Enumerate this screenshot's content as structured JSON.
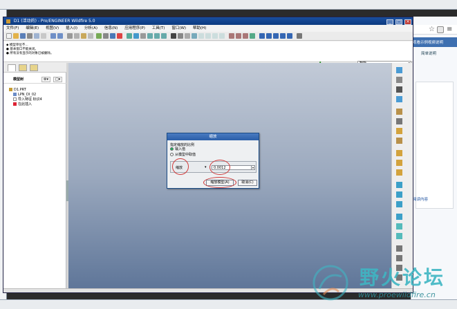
{
  "window": {
    "title": "D1 (活动的) - Pro/ENGINEER Wildfire 5.0"
  },
  "menubar": [
    "文件(F)",
    "编辑(E)",
    "视图(V)",
    "插入(I)",
    "分析(A)",
    "信息(N)",
    "应用程序(P)",
    "工具(T)",
    "窗口(W)",
    "帮助(H)"
  ],
  "message_area": {
    "lines": [
      "◆ 模型单位不...",
      "● 基本窗口不能关闭。",
      "● 所有没有显示的对象已被删除。"
    ],
    "selection_filter": "智能"
  },
  "navigator": {
    "title": "模型树",
    "settings_icon": "tree-settings-icon",
    "show_icon": "tree-show-icon",
    "items": [
      {
        "label": "D1.PRT",
        "icon": "part-icon"
      },
      {
        "label": "LPN_DI_02",
        "icon": "layer-icon"
      },
      {
        "label": "导入特征 标识4",
        "icon": "import-feature-icon"
      },
      {
        "label": "在此插入",
        "icon": "insert-here-icon"
      }
    ]
  },
  "dialog": {
    "title": "缩放",
    "prompt": "指定缩放的比例",
    "option_typed": "输入值",
    "option_picked": "从模型中取值",
    "unit_label": "缩放",
    "value": "0.0012",
    "ok": "缩放模型(A)",
    "cancel": "取消(C)"
  },
  "browser": {
    "banner": "观看示例视频说明",
    "panel_title": "简单说明",
    "bottom_link": "阅读内容"
  },
  "watermark": {
    "title": "野火论坛",
    "url": "www.proewildfire.cn"
  },
  "colors": {
    "titlebar": "#1a4f9e",
    "graphics_top": "#c2cad7",
    "graphics_bottom": "#5f7699",
    "annotation": "#d03a3a",
    "watermark": "#3fb6c3"
  }
}
